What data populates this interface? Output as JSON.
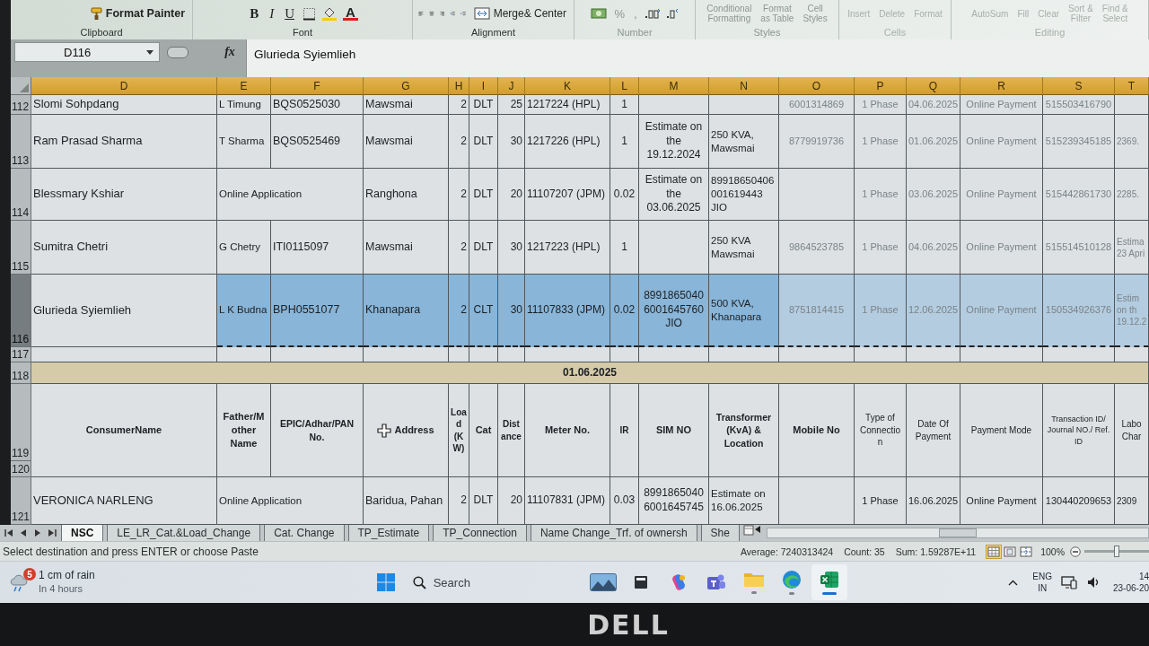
{
  "ribbon": {
    "groups": [
      {
        "kind": "clipboard",
        "label": "Clipboard",
        "buttons": [
          "Format Painter"
        ]
      },
      {
        "kind": "font",
        "label": "Font",
        "buttons": [
          "B",
          "I",
          "U",
          "A"
        ]
      },
      {
        "kind": "alignment",
        "label": "Alignment",
        "buttons": [
          "Merge& Center"
        ]
      },
      {
        "kind": "number",
        "label": "Number",
        "buttons": [
          "%",
          ","
        ]
      },
      {
        "kind": "styles",
        "label": "Styles",
        "buttons": [
          "Conditional\nFormatting",
          "Format\nas Table",
          "Cell\nStyles"
        ]
      },
      {
        "kind": "cells",
        "label": "Cells",
        "buttons": [
          "Insert",
          "Delete",
          "Format"
        ]
      },
      {
        "kind": "editing",
        "label": "Editing",
        "buttons": [
          "AutoSum",
          "Fill",
          "Clear",
          "Sort &\nFilter",
          "Find &\nSelect"
        ]
      }
    ]
  },
  "formula_bar": {
    "name_box": "D116",
    "function_button": "fx",
    "value": "Glurieda Syiemlieh"
  },
  "sheet": {
    "columns": [
      {
        "label": "D",
        "selected": true
      },
      {
        "label": "E",
        "selected": true
      },
      {
        "label": "F",
        "selected": true
      },
      {
        "label": "G",
        "selected": true
      },
      {
        "label": "H",
        "selected": true
      },
      {
        "label": "I",
        "selected": true
      },
      {
        "label": "J",
        "selected": true
      },
      {
        "label": "K",
        "selected": true
      },
      {
        "label": "L",
        "selected": true
      },
      {
        "label": "M",
        "selected": true
      },
      {
        "label": "N",
        "selected": true
      },
      {
        "label": "O",
        "selected": true
      },
      {
        "label": "P",
        "selected": true
      },
      {
        "label": "Q",
        "selected": true
      },
      {
        "label": "R",
        "selected": true
      },
      {
        "label": "S",
        "selected": true
      },
      {
        "label": "T",
        "selected": true
      }
    ],
    "rows": [
      {
        "kind": "data",
        "number": "112",
        "selected": false,
        "cells": [
          "Slomi Sohpdang",
          "L Timung",
          "BQS0525030",
          "Mawsmai",
          "2",
          "DLT",
          "25",
          "1217224 (HPL)",
          "1",
          null,
          null,
          "6001314869",
          "1 Phase",
          "04.06.2025",
          "Online Payment",
          "515503416790"
        ]
      },
      {
        "kind": "data",
        "number": "113",
        "selected": false,
        "cells": [
          "Ram Prasad Sharma",
          "T Sharma",
          "BQS0525469",
          "Mawsmai",
          "2",
          "DLT",
          "30",
          "1217226 (HPL)",
          "1",
          "Estimate on\nthe\n19.12.2024",
          "250 KVA,\nMawsmai",
          "8779919736",
          "1 Phase",
          "01.06.2025",
          "Online Payment",
          "515239345185",
          "2369."
        ]
      },
      {
        "kind": "data",
        "number": "114",
        "selected": false,
        "cells": [
          "Blessmary Kshiar",
          {
            "kind": "merged",
            "text": "Online Application"
          },
          "Ranghona",
          "2",
          "DLT",
          "20",
          "11107207 (JPM)",
          "0.02",
          "Estimate on\nthe\n03.06.2025",
          "89918650406\n001619443\nJIO",
          null,
          "1 Phase",
          "03.06.2025",
          "Online Payment",
          "515442861730",
          "2285."
        ]
      },
      {
        "kind": "data",
        "number": "115",
        "selected": false,
        "cells": [
          "Sumitra Chetri",
          "G Chetry",
          "ITI0115097",
          "Mawsmai",
          "2",
          "DLT",
          "30",
          "1217223 (HPL)",
          "1",
          null,
          "250 KVA\nMawsmai",
          "9864523785",
          "1 Phase",
          "04.06.2025",
          "Online Payment",
          "515514510128",
          "Estima\n23 Apri"
        ]
      },
      {
        "kind": "data",
        "number": "116",
        "selected": true,
        "cells": [
          "Glurieda Syiemlieh",
          "L K Budna",
          "BPH0551077",
          "Khanapara",
          "2",
          "CLT",
          "30",
          "11107833 (JPM)",
          "0.02",
          "8991865040\n6001645760\nJIO",
          "500 KVA,\nKhanapara",
          "8751814415",
          "1 Phase",
          "12.06.2025",
          "Online Payment",
          "150534926376",
          "Estim\non th\n19.12.2"
        ]
      },
      {
        "kind": "blank",
        "number": "117",
        "selected": false
      },
      {
        "kind": "band",
        "number": "118",
        "selected": false,
        "title": "01.06.2025"
      },
      {
        "kind": "heading",
        "numbers": [
          "119",
          "120"
        ],
        "selected": false,
        "cells": [
          "ConsumerName",
          "Father/M\nother\nName",
          "EPIC/Adhar/PAN\nNo.",
          "Address",
          "Loa\nd\n(K\nW)",
          "Cat",
          "Dist\nance",
          "Meter No.",
          "IR",
          "SIM NO",
          "Transformer\n(KvA) &\nLocation",
          "Mobile No",
          "Type of\nConnectio\nn",
          "Date Of\nPayment",
          "Payment Mode",
          "Transaction ID/\nJournal NO./ Ref.\nID",
          "Labo\nChar"
        ]
      },
      {
        "kind": "data",
        "number": "121",
        "selected": false,
        "cells": [
          "VERONICA NARLENG",
          {
            "kind": "merged",
            "text": "Online Application"
          },
          "Baridua, Pahan",
          "2",
          "DLT",
          "20",
          "11107831 (JPM)",
          "0.03",
          "8991865040\n6001645745",
          "Estimate on\n16.06.2025",
          null,
          "1 Phase",
          "16.06.2025",
          "Online Payment",
          "130440209653",
          "2309"
        ]
      }
    ]
  },
  "sheet_tabs": [
    {
      "label": "NSC",
      "selected": true
    },
    {
      "label": "LE_LR_Cat.&Load_Change",
      "selected": false
    },
    {
      "label": "Cat. Change",
      "selected": false
    },
    {
      "label": "TP_Estimate",
      "selected": false
    },
    {
      "label": "TP_Connection",
      "selected": false
    },
    {
      "label": "Name Change_Trf. of ownersh",
      "selected": false
    },
    {
      "label": "She",
      "selected": false
    }
  ],
  "status_bar": {
    "message": "Select destination and press ENTER or choose Paste",
    "average": "Average: 7240313424",
    "count": "Count: 35",
    "sum": "Sum: 1.59287E+11",
    "views": [
      {
        "kind": "normal",
        "selected": true
      },
      {
        "kind": "page-layout",
        "selected": false
      },
      {
        "kind": "page-break",
        "selected": false
      }
    ],
    "zoom": "100%",
    "zoom_slider": {
      "level": 0.5
    }
  },
  "taskbar": {
    "weather": {
      "badge": "5",
      "title": "1 cm of rain",
      "subtitle": "In 4 hours"
    },
    "search": {
      "placeholder": "Search"
    },
    "apps": [
      {
        "kind": "gallery",
        "running": false,
        "active": false
      },
      {
        "kind": "square",
        "running": false,
        "active": false
      },
      {
        "kind": "copilot",
        "running": false,
        "active": false
      },
      {
        "kind": "teams",
        "running": false,
        "active": false
      },
      {
        "kind": "folder",
        "running": true,
        "active": false
      },
      {
        "kind": "edge",
        "running": true,
        "active": false
      },
      {
        "kind": "excel",
        "running": true,
        "active": true
      }
    ],
    "language": [
      "ENG",
      "IN"
    ],
    "time": "14",
    "date": "23-06-20"
  },
  "monitor": {
    "logo": "DELL"
  }
}
